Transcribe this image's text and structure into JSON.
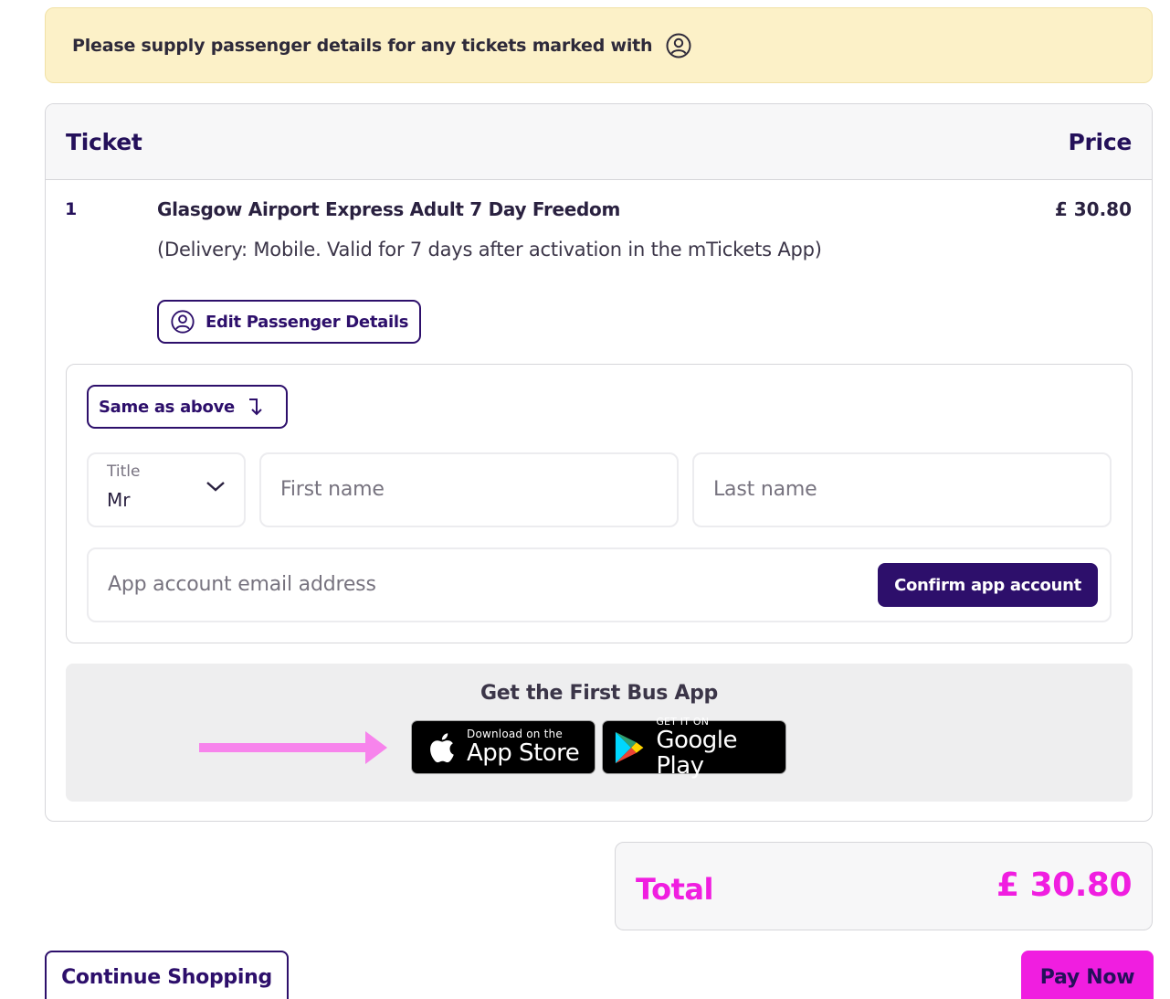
{
  "notice": {
    "text": "Please supply passenger details for any tickets marked with",
    "icon": "person-circle-icon"
  },
  "table": {
    "header_ticket": "Ticket",
    "header_price": "Price",
    "row": {
      "index": "1",
      "name": "Glasgow Airport Express Adult 7 Day Freedom",
      "description": "(Delivery: Mobile. Valid for 7 days after activation in the mTickets App)",
      "price": "£ 30.80",
      "edit_label": "Edit Passenger Details"
    }
  },
  "form": {
    "same_label": "Same as above",
    "title_label": "Title",
    "title_value": "Mr",
    "first_name_placeholder": "First name",
    "last_name_placeholder": "Last name",
    "email_placeholder": "App account email address",
    "confirm_label": "Confirm app account"
  },
  "app": {
    "title": "Get the First Bus App",
    "appstore_small": "Download on the",
    "appstore_big": "App Store",
    "gplay_small": "GET IT ON",
    "gplay_big": "Google Play"
  },
  "total": {
    "label": "Total",
    "value": "£ 30.80"
  },
  "footer": {
    "continue_label": "Continue Shopping",
    "pay_label": "Pay Now"
  },
  "colors": {
    "brand_purple": "#2d0f6b",
    "accent_pink": "#f01ee0",
    "notice_bg": "#fcf1c8"
  }
}
